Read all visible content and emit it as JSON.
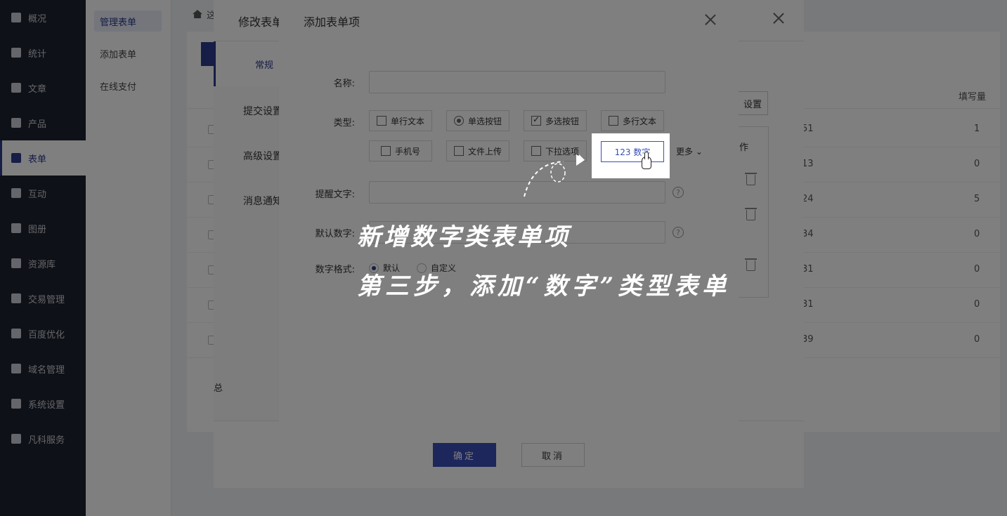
{
  "sidebar": {
    "items": [
      {
        "label": "概况",
        "icon": "home-icon"
      },
      {
        "label": "统计",
        "icon": "chart-icon"
      },
      {
        "label": "文章",
        "icon": "article-icon"
      },
      {
        "label": "产品",
        "icon": "product-icon"
      },
      {
        "label": "表单",
        "icon": "form-icon",
        "active": true
      },
      {
        "label": "互动",
        "icon": "chat-icon"
      },
      {
        "label": "图册",
        "icon": "gallery-icon"
      },
      {
        "label": "资源库",
        "icon": "database-icon"
      },
      {
        "label": "交易管理",
        "icon": "trade-icon"
      },
      {
        "label": "百度优化",
        "icon": "seo-icon"
      },
      {
        "label": "域名管理",
        "icon": "domain-icon"
      },
      {
        "label": "系统设置",
        "icon": "gear-icon"
      },
      {
        "label": "凡科服务",
        "icon": "heart-icon"
      }
    ]
  },
  "subnav": {
    "items": [
      {
        "label": "管理表单",
        "active": true
      },
      {
        "label": "添加表单"
      },
      {
        "label": "在线支付"
      }
    ]
  },
  "main": {
    "breadcrumb": "这",
    "table": {
      "fill_count_header": "填写量",
      "rows": [
        {
          "id": "51",
          "count": "1"
        },
        {
          "id": "13",
          "count": "0"
        },
        {
          "id": "24",
          "count": "5"
        },
        {
          "id": "34",
          "count": "0"
        },
        {
          "id": "31",
          "count": "0"
        },
        {
          "id": "31",
          "count": "0"
        },
        {
          "id": "39",
          "count": "0"
        }
      ]
    }
  },
  "edit_modal": {
    "title": "修改表单",
    "tab_general": "常规",
    "side": [
      "提交设置",
      "高级设置",
      "消息通知"
    ],
    "settings_button": "设置",
    "ops_label": "作",
    "footer_fragment": "总"
  },
  "add_modal": {
    "title": "添加表单项",
    "name_label": "名称:",
    "type_label": "类型:",
    "types": [
      {
        "label": "单行文本",
        "icon": "single-line-icon"
      },
      {
        "label": "单选按钮",
        "icon": "radio-icon"
      },
      {
        "label": "多选按钮",
        "icon": "checkbox-icon"
      },
      {
        "label": "多行文本",
        "icon": "multi-line-icon"
      },
      {
        "label": "手机号",
        "icon": "phone-icon"
      },
      {
        "label": "文件上传",
        "icon": "upload-icon"
      },
      {
        "label": "下拉选项",
        "icon": "dropdown-icon"
      },
      {
        "label": "123  数字",
        "icon": "number-icon"
      }
    ],
    "more": "更多",
    "hint_label": "提醒文字:",
    "default_number_label": "默认数字:",
    "number_format_label": "数字格式:",
    "format_default": "默认",
    "format_custom": "自定义",
    "help": "?",
    "ok": "确定",
    "cancel": "取消"
  },
  "annotation": {
    "line1": "新增数字类表单项",
    "line2": "第三步，添加“数字”类型表单"
  }
}
